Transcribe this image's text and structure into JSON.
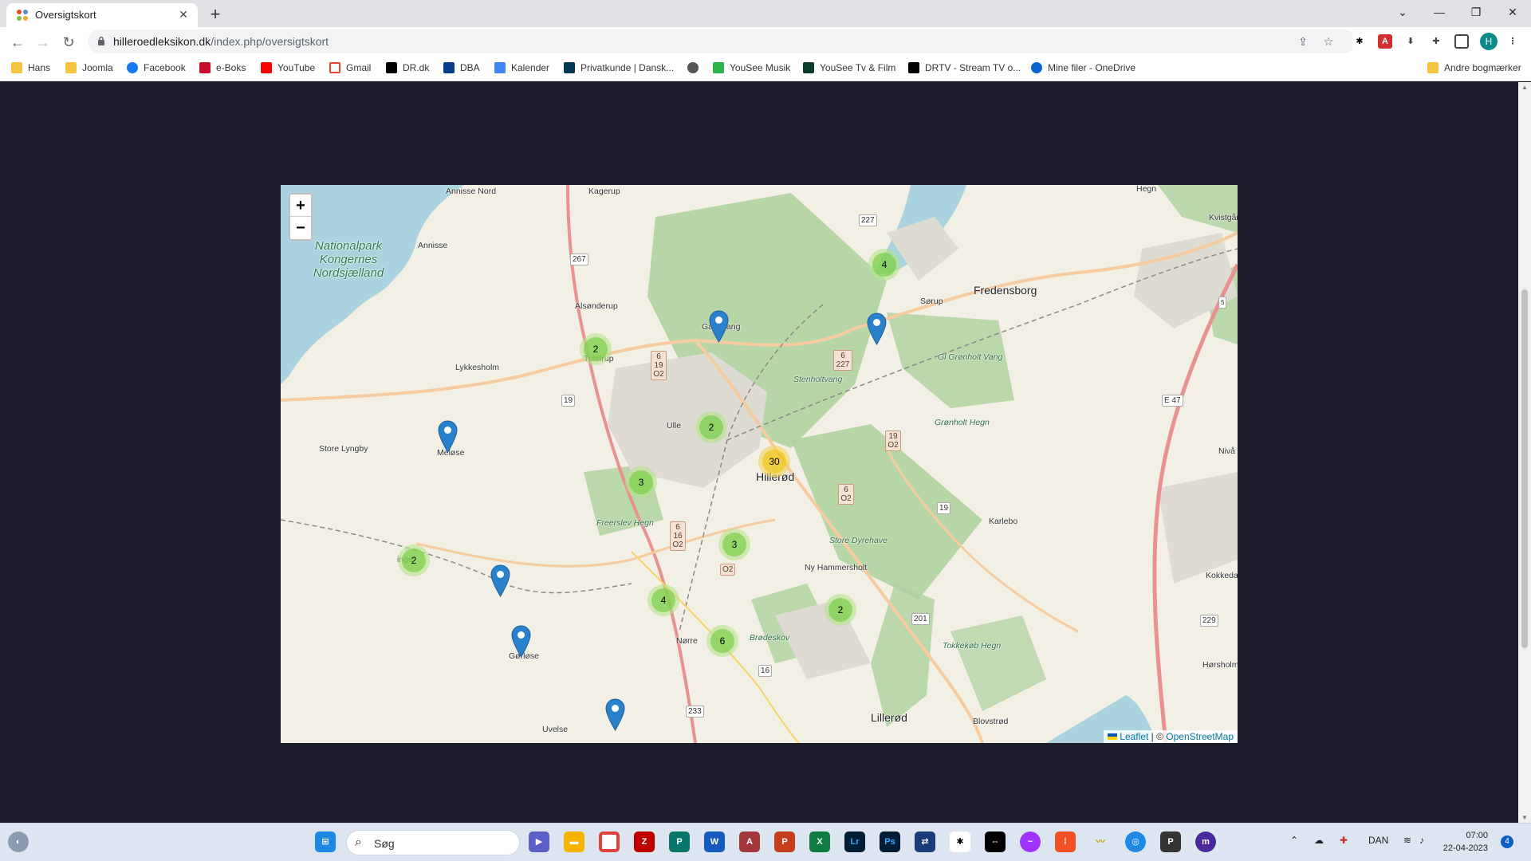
{
  "browser": {
    "tab_title": "Oversigtskort",
    "new_tab_label": "+",
    "url_host": "hilleroedleksikon.dk",
    "url_path": "/index.php/oversigtskort",
    "profile_initial": "H"
  },
  "bookmarks": [
    {
      "label": "Hans",
      "icon": "folder-icon"
    },
    {
      "label": "Joomla",
      "icon": "folder-icon"
    },
    {
      "label": "Facebook",
      "icon": "facebook-icon"
    },
    {
      "label": "e-Boks",
      "icon": "eboks-icon"
    },
    {
      "label": "YouTube",
      "icon": "youtube-icon"
    },
    {
      "label": "Gmail",
      "icon": "gmail-icon"
    },
    {
      "label": "DR.dk",
      "icon": "dr-icon"
    },
    {
      "label": "DBA",
      "icon": "dba-icon"
    },
    {
      "label": "Kalender",
      "icon": "calendar-icon"
    },
    {
      "label": "Privatkunde | Dansk...",
      "icon": "bank-icon"
    },
    {
      "label": "",
      "icon": "globe-icon"
    },
    {
      "label": "YouSee Musik",
      "icon": "music-icon"
    },
    {
      "label": "YouSee Tv & Film",
      "icon": "tv-icon"
    },
    {
      "label": "DRTV - Stream TV o...",
      "icon": "drtv-icon"
    },
    {
      "label": "Mine filer - OneDrive",
      "icon": "onedrive-icon"
    }
  ],
  "other_bookmarks": "Andre bogmærker",
  "map": {
    "zoom_in": "+",
    "zoom_out": "−",
    "places": {
      "annisse_nord": "Annisse Nord",
      "kagerup": "Kagerup",
      "annisse": "Annisse",
      "hegn_top": "Hegn",
      "kvistgaard": "Kvistgård",
      "alsonderup": "Alsønderup",
      "tulstrup": "Tulstrup",
      "gadevang": "Gadevang",
      "sorup": "Sørup",
      "fredensborg": "Fredensborg",
      "lykkesholm": "Lykkesholm",
      "store_lyngby": "Store Lyngby",
      "meloese": "Meløse",
      "ullerod": "Ulle",
      "hillerod": "Hillerød",
      "niva": "Nivå",
      "karlebo": "Karlebo",
      "store_dyrehave": "Store Dyrehave",
      "ny_hammersholt": "Ny Hammersholt",
      "kokkedal": "Kokkedal",
      "horsholm": "Hørsholm",
      "skaevinge": "inge",
      "norre": "Nørre",
      "gorloese": "Gørløse",
      "uvelse": "Uvelse",
      "lillerod": "Lillerød",
      "blovstrod": "Blovstrød",
      "stenholtvang": "Stenholtvang",
      "gronholt_vang": "Gl Grønholt Vang",
      "gronholt_hegn": "Grønholt Hegn",
      "freerslev_hegn": "Freerslev Hegn",
      "brodeskov": "Brødeskov",
      "tokkekob_hegn": "Tokkekøb Hegn",
      "national_park": "Nationalpark Kongernes Nordsjælland"
    },
    "road_shields": {
      "r267": "267",
      "r227": "227",
      "r6_19_o2": "6 19 O2",
      "r6_227": "6 227",
      "r19_left": "19",
      "r19_o2": "19 O2",
      "r6_o2": "6 O2",
      "r19_right": "19",
      "r6_16_o2": "6 16 O2",
      "r_o2": "O2",
      "r_e47": "E 47",
      "r201": "201",
      "r229": "229",
      "r16": "16",
      "r233": "233",
      "r5": "5"
    },
    "clusters": [
      {
        "id": "cluster-gadevang-north",
        "count": "4",
        "size": "small"
      },
      {
        "id": "cluster-alsonderup",
        "count": "2",
        "size": "small"
      },
      {
        "id": "cluster-ullerod",
        "count": "2",
        "size": "small"
      },
      {
        "id": "cluster-hillerod",
        "count": "30",
        "size": "medium"
      },
      {
        "id": "cluster-freerslev",
        "count": "3",
        "size": "small"
      },
      {
        "id": "cluster-south-hillerod",
        "count": "3",
        "size": "small"
      },
      {
        "id": "cluster-skaevinge",
        "count": "2",
        "size": "small"
      },
      {
        "id": "cluster-nejede",
        "count": "4",
        "size": "small"
      },
      {
        "id": "cluster-ny-hammersholt",
        "count": "2",
        "size": "small"
      },
      {
        "id": "cluster-nr-herlev",
        "count": "6",
        "size": "small"
      }
    ],
    "marker_color": "#2a81cb",
    "attribution": {
      "leaflet": "Leaflet",
      "separator": " | © ",
      "osm": "OpenStreetMap"
    }
  },
  "taskbar": {
    "search_label": "Søg",
    "language": "DAN",
    "time": "07:00",
    "date": "22-04-2023",
    "notifications": "4"
  },
  "colors": {
    "page_background": "#1c1c2a",
    "water": "#aad3df",
    "forest": "#add19e",
    "accent": "#2a81cb"
  }
}
